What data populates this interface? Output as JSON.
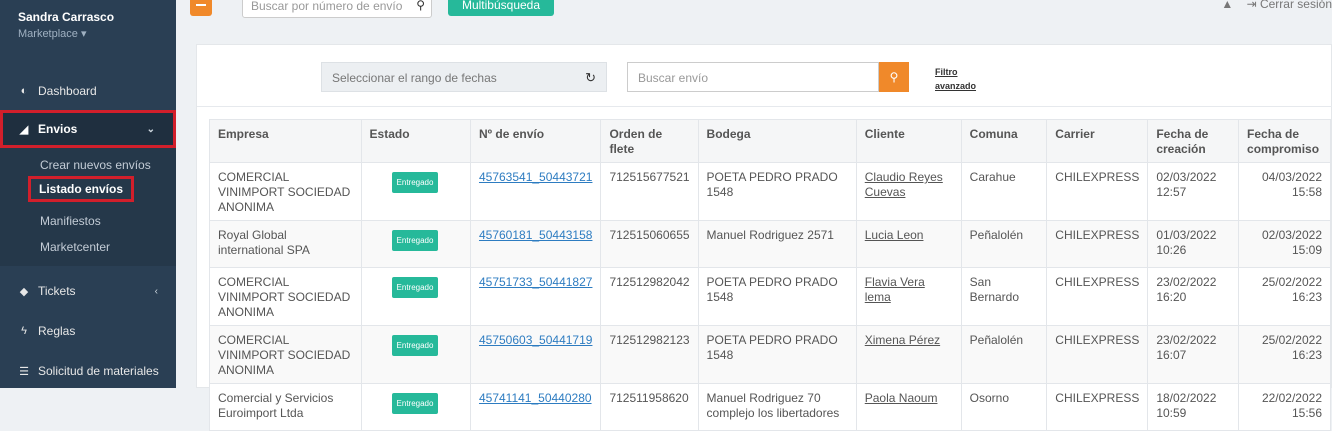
{
  "sidebar": {
    "user_name": "Sandra Carrasco",
    "user_role": "Marketplace ▾",
    "items": [
      {
        "label": "Dashboard",
        "icon": "dashboard-icon",
        "glyph": "◐"
      },
      {
        "label": "Envios",
        "icon": "send-icon",
        "glyph": "◢",
        "chevron": "⌄"
      },
      {
        "label": "Tickets",
        "icon": "ticket-icon",
        "glyph": "◆",
        "chevron": "‹"
      },
      {
        "label": "Reglas",
        "icon": "bolt-icon",
        "glyph": "ϟ"
      },
      {
        "label": "Solicitud de materiales",
        "icon": "list-icon",
        "glyph": "☰"
      }
    ],
    "submenu": [
      "Crear nuevos envíos",
      "Listado envíos",
      "Manifiestos",
      "Marketcenter"
    ]
  },
  "topbar": {
    "search_placeholder": "Buscar por número de envío",
    "search_icon": "⚲",
    "multi_button": "Multibúsqueda",
    "bell": "▲",
    "logout": "⇥ Cerrar sesión"
  },
  "filters": {
    "date_range": "Seleccionar el rango de fechas",
    "refresh_icon": "↻",
    "search_placeholder": "Buscar envío",
    "search_icon": "⚲",
    "filtro_line1": "Filtro",
    "filtro_line2": "avanzado"
  },
  "table": {
    "headers": [
      "Empresa",
      "Estado",
      "Nº de envío",
      "Orden de flete",
      "Bodega",
      "Cliente",
      "Comuna",
      "Carrier",
      "Fecha de creación",
      "Fecha de compromiso"
    ],
    "rows": [
      {
        "empresa": "COMERCIAL VINIMPORT SOCIEDAD ANONIMA",
        "estado": "Entregado",
        "envio": "45763541_50443721",
        "flete": "712515677521",
        "bodega": "POETA PEDRO PRADO 1548",
        "cliente": "Claudio Reyes Cuevas",
        "comuna": "Carahue",
        "carrier": "CHILEXPRESS",
        "creacion": "02/03/2022 12:57",
        "compromiso": "04/03/2022 15:58"
      },
      {
        "empresa": "Royal Global international SPA",
        "estado": "Entregado",
        "envio": "45760181_50443158",
        "flete": "712515060655",
        "bodega": "Manuel Rodriguez 2571",
        "cliente": "Lucia Leon",
        "comuna": "Peñalolén",
        "carrier": "CHILEXPRESS",
        "creacion": "01/03/2022 10:26",
        "compromiso": "02/03/2022 15:09"
      },
      {
        "empresa": "COMERCIAL VINIMPORT SOCIEDAD ANONIMA",
        "estado": "Entregado",
        "envio": "45751733_50441827",
        "flete": "712512982042",
        "bodega": "POETA PEDRO PRADO 1548",
        "cliente": "Flavia Vera lema",
        "comuna": "San Bernardo",
        "carrier": "CHILEXPRESS",
        "creacion": "23/02/2022 16:20",
        "compromiso": "25/02/2022 16:23"
      },
      {
        "empresa": "COMERCIAL VINIMPORT SOCIEDAD ANONIMA",
        "estado": "Entregado",
        "envio": "45750603_50441719",
        "flete": "712512982123",
        "bodega": "POETA PEDRO PRADO 1548",
        "cliente": "Ximena Pérez",
        "comuna": "Peñalolén",
        "carrier": "CHILEXPRESS",
        "creacion": "23/02/2022 16:07",
        "compromiso": "25/02/2022 16:23"
      },
      {
        "empresa": "Comercial y Servicios Euroimport Ltda",
        "estado": "Entregado",
        "envio": "45741141_50440280",
        "flete": "712511958620",
        "bodega": "Manuel Rodriguez 70 complejo los libertadores",
        "cliente": "Paola Naoum",
        "comuna": "Osorno",
        "carrier": "CHILEXPRESS",
        "creacion": "18/02/2022 10:59",
        "compromiso": "22/02/2022 15:56"
      }
    ]
  }
}
